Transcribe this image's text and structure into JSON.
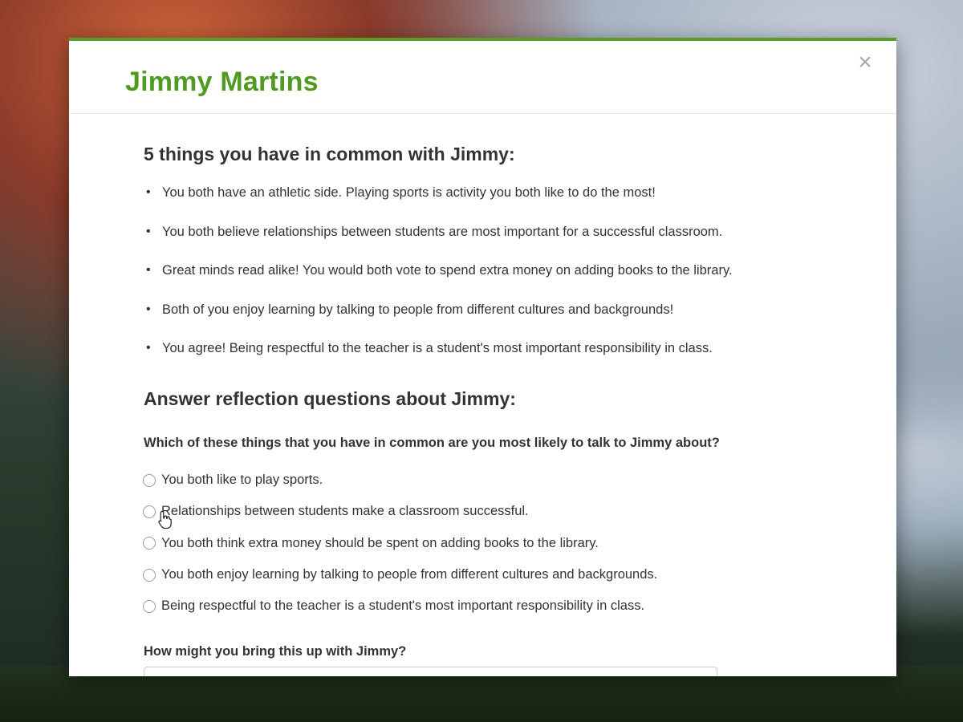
{
  "modal": {
    "title": "Jimmy Martins",
    "close_label": "×"
  },
  "common": {
    "heading": "5 things you have in common with Jimmy:",
    "items": [
      "You both have an athletic side. Playing sports is activity you both like to do the most!",
      "You both believe relationships between students are most important for a successful classroom.",
      "Great minds read alike! You would both vote to spend extra money on adding books to the library.",
      "Both of you enjoy learning by talking to people from different cultures and backgrounds!",
      "You agree! Being respectful to the teacher is a student's most important responsibility in class."
    ]
  },
  "reflection": {
    "heading": "Answer reflection questions about Jimmy:",
    "question1": "Which of these things that you have in common are you most likely to talk to Jimmy about?",
    "options": [
      "You both like to play sports.",
      "Relationships between students make a classroom successful.",
      "You both think extra money should be spent on adding books to the library.",
      "You both enjoy learning by talking to people from different cultures and backgrounds.",
      "Being respectful to the teacher is a student's most important responsibility in class."
    ],
    "question2": "How might you bring this up with Jimmy?",
    "answer_value": ""
  },
  "colors": {
    "accent": "#4f9a22",
    "top_border": "#5a9e2a",
    "text": "#333333"
  },
  "icons": {
    "close": "close-icon",
    "cursor": "hand-pointer-icon"
  }
}
